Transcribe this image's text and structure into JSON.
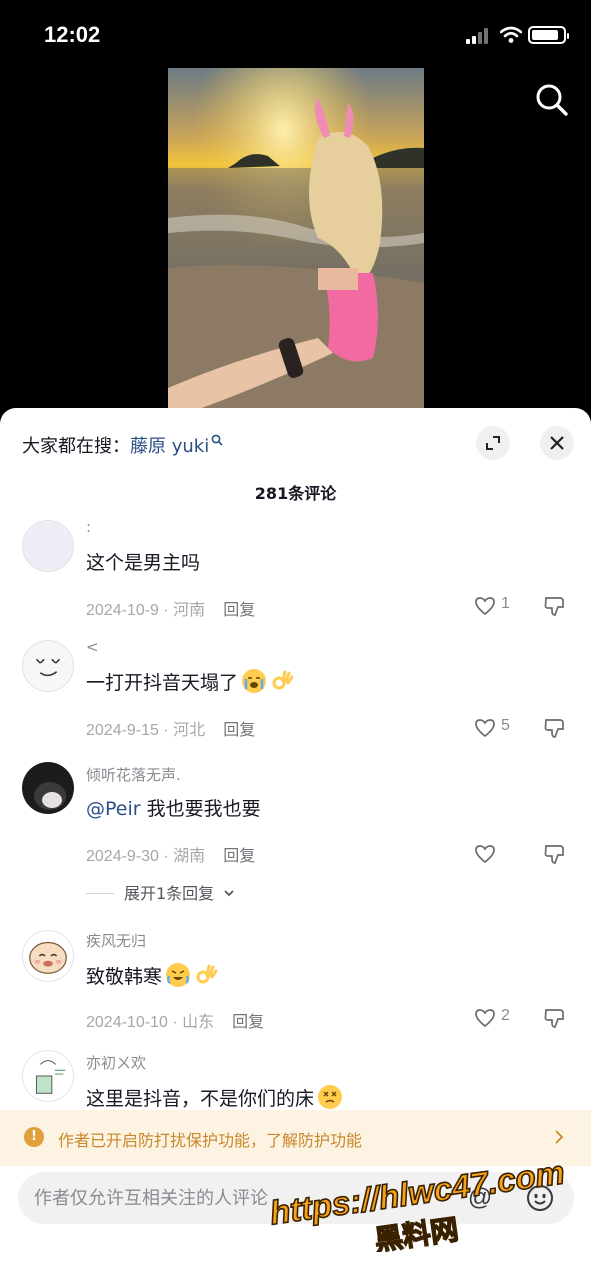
{
  "status_bar": {
    "time": "12:02",
    "battery_level": 0.85
  },
  "video": {
    "description_icon": "search-icon"
  },
  "sheet": {
    "trending_prefix": "大家都在搜：",
    "trending_keyword": "藤原 yuki",
    "comment_count": "281条评论"
  },
  "comments": [
    {
      "username": ":",
      "text": "这个是男主吗",
      "emoji": [],
      "date": "2024-10-9",
      "location": "河南",
      "reply": "回复",
      "likes": "1",
      "liked_count_visible": true
    },
    {
      "username": "<",
      "text": "一打开抖音天塌了",
      "emoji": [
        "loudly-crying-face",
        "ok-hand"
      ],
      "date": "2024-9-15",
      "location": "河北",
      "reply": "回复",
      "likes": "5"
    },
    {
      "username": "倾听花落无声.",
      "mention": "@Peir",
      "text": " 我也要我也要",
      "date": "2024-9-30",
      "location": "湖南",
      "reply": "回复",
      "likes": "",
      "expand": "展开1条回复"
    },
    {
      "username": "疾风无归",
      "text": "致敬韩寒",
      "emoji": [
        "rolling-laughing-face",
        "ok-hand"
      ],
      "date": "2024-10-10",
      "location": "山东",
      "reply": "回复",
      "likes": "2"
    },
    {
      "username": "亦初ㄨ欢",
      "text": "这里是抖音，不是你们的床",
      "emoji": [
        "dizzy-face"
      ]
    }
  ],
  "protection_notice": "作者已开启防打扰保护功能，了解防护功能",
  "input": {
    "placeholder": "作者仅允许互相关注的人评论",
    "at_label": "@"
  },
  "watermark": {
    "line1": "https://hlwc47.com",
    "line2": "黑料网"
  },
  "colors": {
    "link": "#2b4e86",
    "notice_text": "#c8872a",
    "notice_bg": "#fdf3e3"
  }
}
